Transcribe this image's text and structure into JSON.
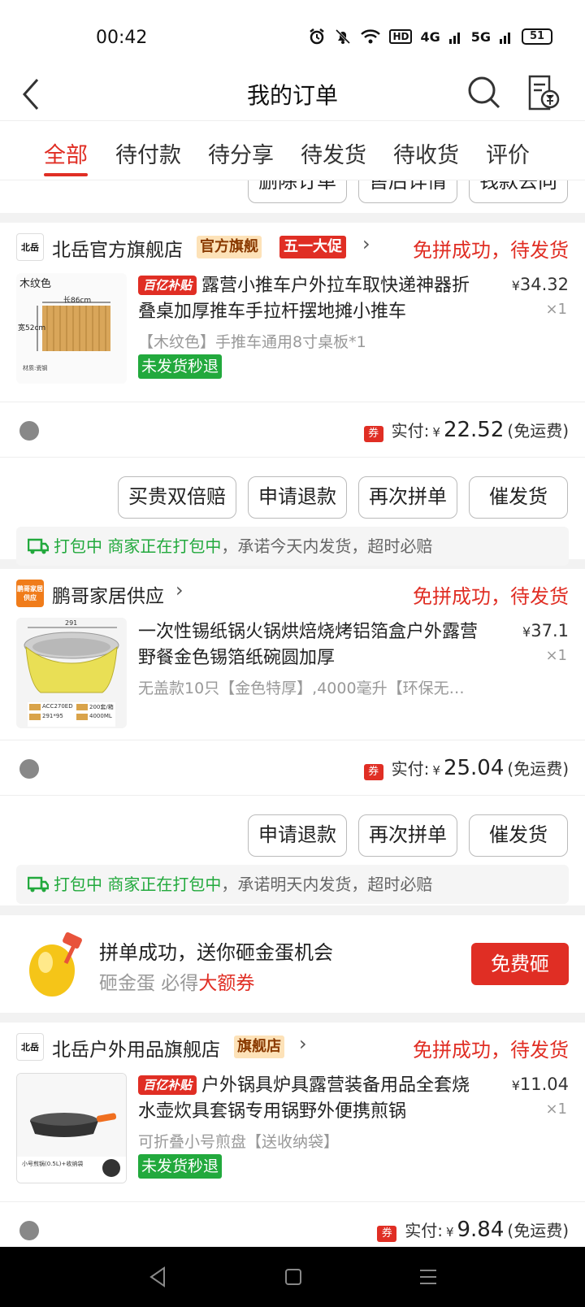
{
  "status": {
    "time": "00:42",
    "network1": "4G",
    "network2": "5G",
    "hd": "HD",
    "battery": "51"
  },
  "nav": {
    "title": "我的订单"
  },
  "tabs": [
    {
      "label": "全部"
    },
    {
      "label": "待付款"
    },
    {
      "label": "待分享"
    },
    {
      "label": "待发货"
    },
    {
      "label": "待收货"
    },
    {
      "label": "评价"
    }
  ],
  "prev_order": {
    "buttons": [
      "删除订单",
      "售后详情",
      "钱款去向"
    ]
  },
  "orders": [
    {
      "shop": {
        "logo_text": "北岳",
        "name": "北岳官方旗舰店",
        "tag1": "官方旗舰",
        "tag2": "五一大促"
      },
      "status": "免拼成功，待发货",
      "badge": "百亿补贴",
      "title": "露营小推车户外拉车取快递神器折叠桌加厚推车手拉杆摆地摊小推车",
      "thumb": {
        "label": "木纹色",
        "dim_w": "长86cm",
        "dim_h": "宽52cm",
        "material": "材质:瓷钢"
      },
      "spec": "【木纹色】手推车通用8寸桌板*1",
      "green_tag": "未发货秒退",
      "price": "34.32",
      "currency": "¥",
      "qty": "×1",
      "pay_label": "实付:",
      "coupon": "券",
      "paid": "22.52",
      "shipping": "(免运费)",
      "buttons": [
        "买贵双倍赔",
        "申请退款",
        "再次拼单",
        "催发货"
      ],
      "pack": {
        "status": "打包中",
        "merchant": "商家正在打包中",
        "promise": "，承诺今天内发货，超时必赔"
      }
    },
    {
      "shop": {
        "logo_text": "鹏哥家居供应",
        "name": "鹏哥家居供应"
      },
      "status": "免拼成功，待发货",
      "title": "一次性锡纸锅火锅烘焙烧烤铝箔盒户外露营野餐金色锡箔纸碗圆加厚",
      "thumb": {
        "dim": "291",
        "model": "ACC270ED",
        "size": "291*95",
        "capacity": "4000ML",
        "weight": "200套/箱"
      },
      "spec": "无盖款10只【金色特厚】,4000毫升【环保无…",
      "price": "37.1",
      "currency": "¥",
      "qty": "×1",
      "pay_label": "实付:",
      "coupon": "券",
      "paid": "25.04",
      "shipping": "(免运费)",
      "buttons": [
        "申请退款",
        "再次拼单",
        "催发货"
      ],
      "pack": {
        "status": "打包中",
        "merchant": "商家正在打包中",
        "promise": "，承诺明天内发货，超时必赔"
      }
    },
    {
      "shop": {
        "logo_text": "北岳",
        "name": "北岳户外用品旗舰店",
        "tag1": "旗舰店"
      },
      "status": "免拼成功，待发货",
      "badge": "百亿补贴",
      "title": "户外锅具炉具露营装备用品全套烧水壶炊具套锅专用锅野外便携煎锅",
      "thumb": {
        "caption": "小号煎锅(0.5L)+收纳袋"
      },
      "spec": "可折叠小号煎盘【送收纳袋】",
      "green_tag": "未发货秒退",
      "price": "11.04",
      "currency": "¥",
      "qty": "×1",
      "pay_label": "实付:",
      "coupon": "券",
      "paid": "9.84",
      "shipping": "(免运费)"
    }
  ],
  "promo": {
    "title": "拼单成功，送你砸金蛋机会",
    "sub1": "砸金蛋 必得",
    "sub2": "大额券",
    "button": "免费砸"
  },
  "colors": {
    "accent": "#e02e24",
    "green": "#22a93d"
  }
}
